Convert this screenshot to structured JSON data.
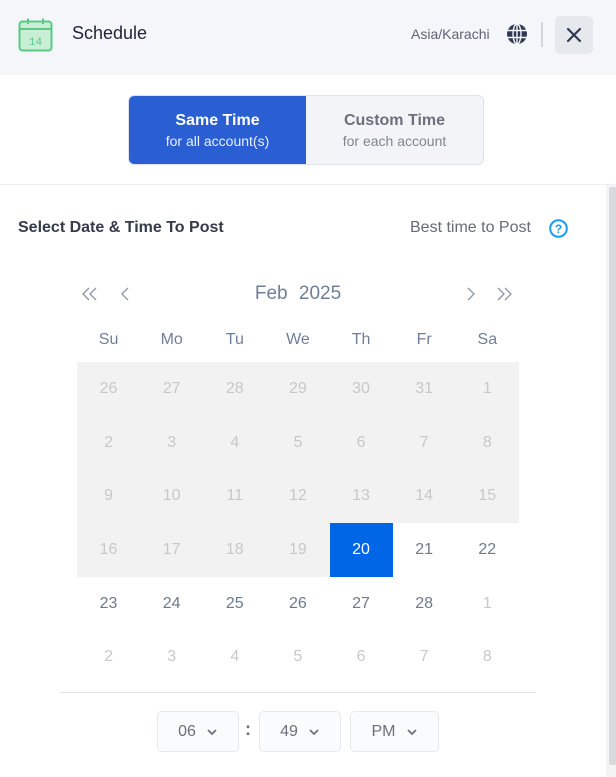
{
  "header": {
    "title": "Schedule",
    "icon": "calendar-icon",
    "icon_day": "14",
    "timezone": "Asia/Karachi",
    "timezone_icon": "globe-icon",
    "close_icon": "close-icon"
  },
  "mode_toggle": {
    "options": [
      {
        "main": "Same Time",
        "sub": "for all account(s)",
        "active": true
      },
      {
        "main": "Custom Time",
        "sub": "for each account",
        "active": false
      }
    ]
  },
  "section": {
    "title": "Select Date & Time To Post",
    "best_time_label": "Best time to Post",
    "help_icon": "question-circle-icon"
  },
  "calendar": {
    "month": "Feb",
    "year": "2025",
    "nav": {
      "prev_year": "double-chevron-left-icon",
      "prev_month": "chevron-left-icon",
      "next_month": "chevron-right-icon",
      "next_year": "double-chevron-right-icon"
    },
    "weekdays": [
      "Su",
      "Mo",
      "Tu",
      "We",
      "Th",
      "Fr",
      "Sa"
    ],
    "weeks": [
      [
        {
          "d": "26",
          "s": "disabled"
        },
        {
          "d": "27",
          "s": "disabled"
        },
        {
          "d": "28",
          "s": "disabled"
        },
        {
          "d": "29",
          "s": "disabled"
        },
        {
          "d": "30",
          "s": "disabled"
        },
        {
          "d": "31",
          "s": "disabled"
        },
        {
          "d": "1",
          "s": "disabled"
        }
      ],
      [
        {
          "d": "2",
          "s": "disabled"
        },
        {
          "d": "3",
          "s": "disabled"
        },
        {
          "d": "4",
          "s": "disabled"
        },
        {
          "d": "5",
          "s": "disabled"
        },
        {
          "d": "6",
          "s": "disabled"
        },
        {
          "d": "7",
          "s": "disabled"
        },
        {
          "d": "8",
          "s": "disabled"
        }
      ],
      [
        {
          "d": "9",
          "s": "disabled"
        },
        {
          "d": "10",
          "s": "disabled"
        },
        {
          "d": "11",
          "s": "disabled"
        },
        {
          "d": "12",
          "s": "disabled"
        },
        {
          "d": "13",
          "s": "disabled"
        },
        {
          "d": "14",
          "s": "disabled"
        },
        {
          "d": "15",
          "s": "disabled"
        }
      ],
      [
        {
          "d": "16",
          "s": "disabled"
        },
        {
          "d": "17",
          "s": "disabled"
        },
        {
          "d": "18",
          "s": "disabled"
        },
        {
          "d": "19",
          "s": "disabled"
        },
        {
          "d": "20",
          "s": "selected"
        },
        {
          "d": "21",
          "s": "normal"
        },
        {
          "d": "22",
          "s": "normal"
        }
      ],
      [
        {
          "d": "23",
          "s": "normal"
        },
        {
          "d": "24",
          "s": "normal"
        },
        {
          "d": "25",
          "s": "normal"
        },
        {
          "d": "26",
          "s": "normal"
        },
        {
          "d": "27",
          "s": "normal"
        },
        {
          "d": "28",
          "s": "normal"
        },
        {
          "d": "1",
          "s": "other"
        }
      ],
      [
        {
          "d": "2",
          "s": "other"
        },
        {
          "d": "3",
          "s": "other"
        },
        {
          "d": "4",
          "s": "other"
        },
        {
          "d": "5",
          "s": "other"
        },
        {
          "d": "6",
          "s": "other"
        },
        {
          "d": "7",
          "s": "other"
        },
        {
          "d": "8",
          "s": "other"
        }
      ]
    ],
    "selected_date": "20"
  },
  "time": {
    "hour": "06",
    "minute": "49",
    "period": "PM",
    "separator": ":"
  },
  "colors": {
    "accent": "#2a5fd4",
    "selected_day": "#0066e6",
    "calendar_icon": "#5cc987",
    "help_icon": "#1a9bf0"
  }
}
